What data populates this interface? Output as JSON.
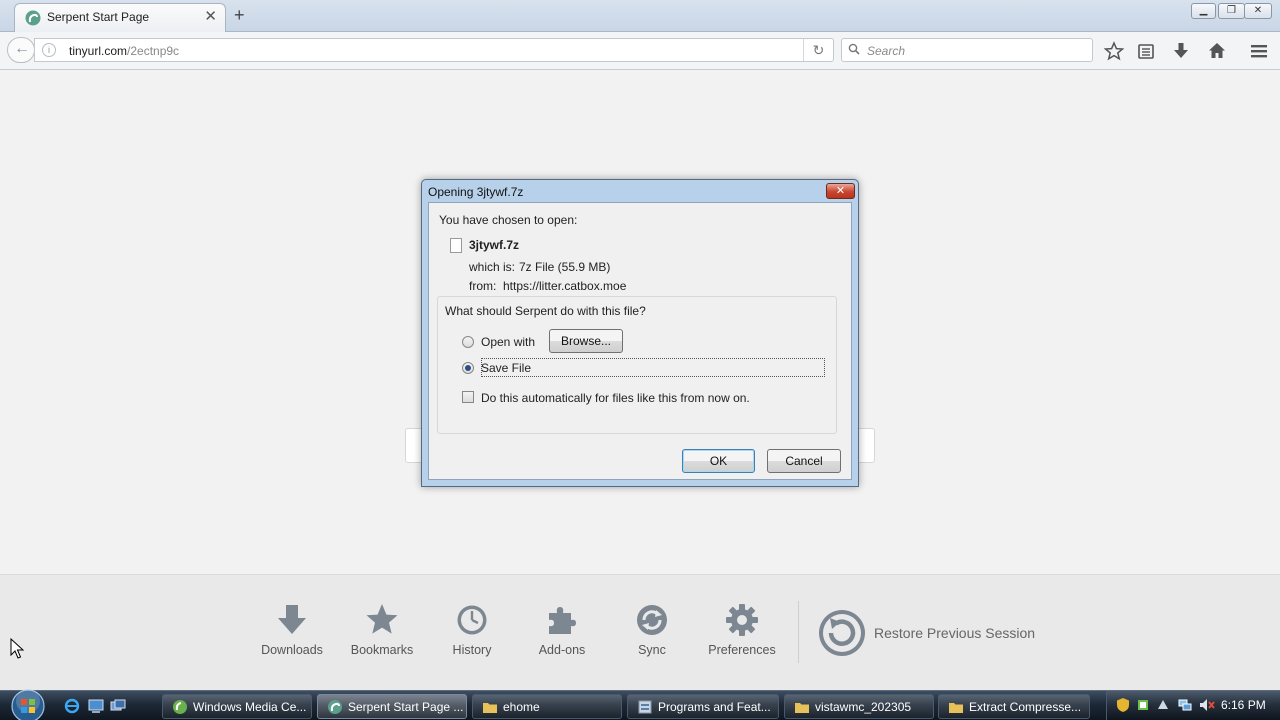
{
  "browser": {
    "tab_title": "Serpent Start Page",
    "url_host": "tinyurl.com",
    "url_path": "/2ectnp9c",
    "search_placeholder": "Search"
  },
  "dialog": {
    "title": "Opening 3jtywf.7z",
    "chosen_label": "You have chosen to open:",
    "file_name": "3jtywf.7z",
    "which_is_label": "which is:",
    "which_is_value": "7z File (55.9 MB)",
    "from_label": "from:",
    "from_value": "https://litter.catbox.moe",
    "question": "What should Serpent do with this file?",
    "open_with_label": "Open with",
    "browse_label": "Browse...",
    "save_file_label": "Save File",
    "auto_label": "Do this automatically for files like this from now on.",
    "ok_label": "OK",
    "cancel_label": "Cancel",
    "selected_option": "save-file"
  },
  "launcher": {
    "items": [
      "Downloads",
      "Bookmarks",
      "History",
      "Add-ons",
      "Sync",
      "Preferences"
    ],
    "restore_label": "Restore Previous Session"
  },
  "taskbar": {
    "items": [
      {
        "label": "Windows Media Ce...",
        "icon": "media-center-icon",
        "active": false
      },
      {
        "label": "Serpent Start Page ...",
        "icon": "serpent-icon",
        "active": true
      },
      {
        "label": "ehome",
        "icon": "folder-icon",
        "active": false
      },
      {
        "label": "Programs and Feat...",
        "icon": "control-panel-icon",
        "active": false
      },
      {
        "label": "vistawmc_202305",
        "icon": "folder-icon",
        "active": false
      },
      {
        "label": "Extract Compresse...",
        "icon": "folder-icon",
        "active": false
      }
    ],
    "clock": "6:16 PM"
  },
  "colors": {
    "dialog_frame": "#b8d1ea",
    "taskbar": "#1d2937",
    "launcher_icon": "#7c8792"
  }
}
